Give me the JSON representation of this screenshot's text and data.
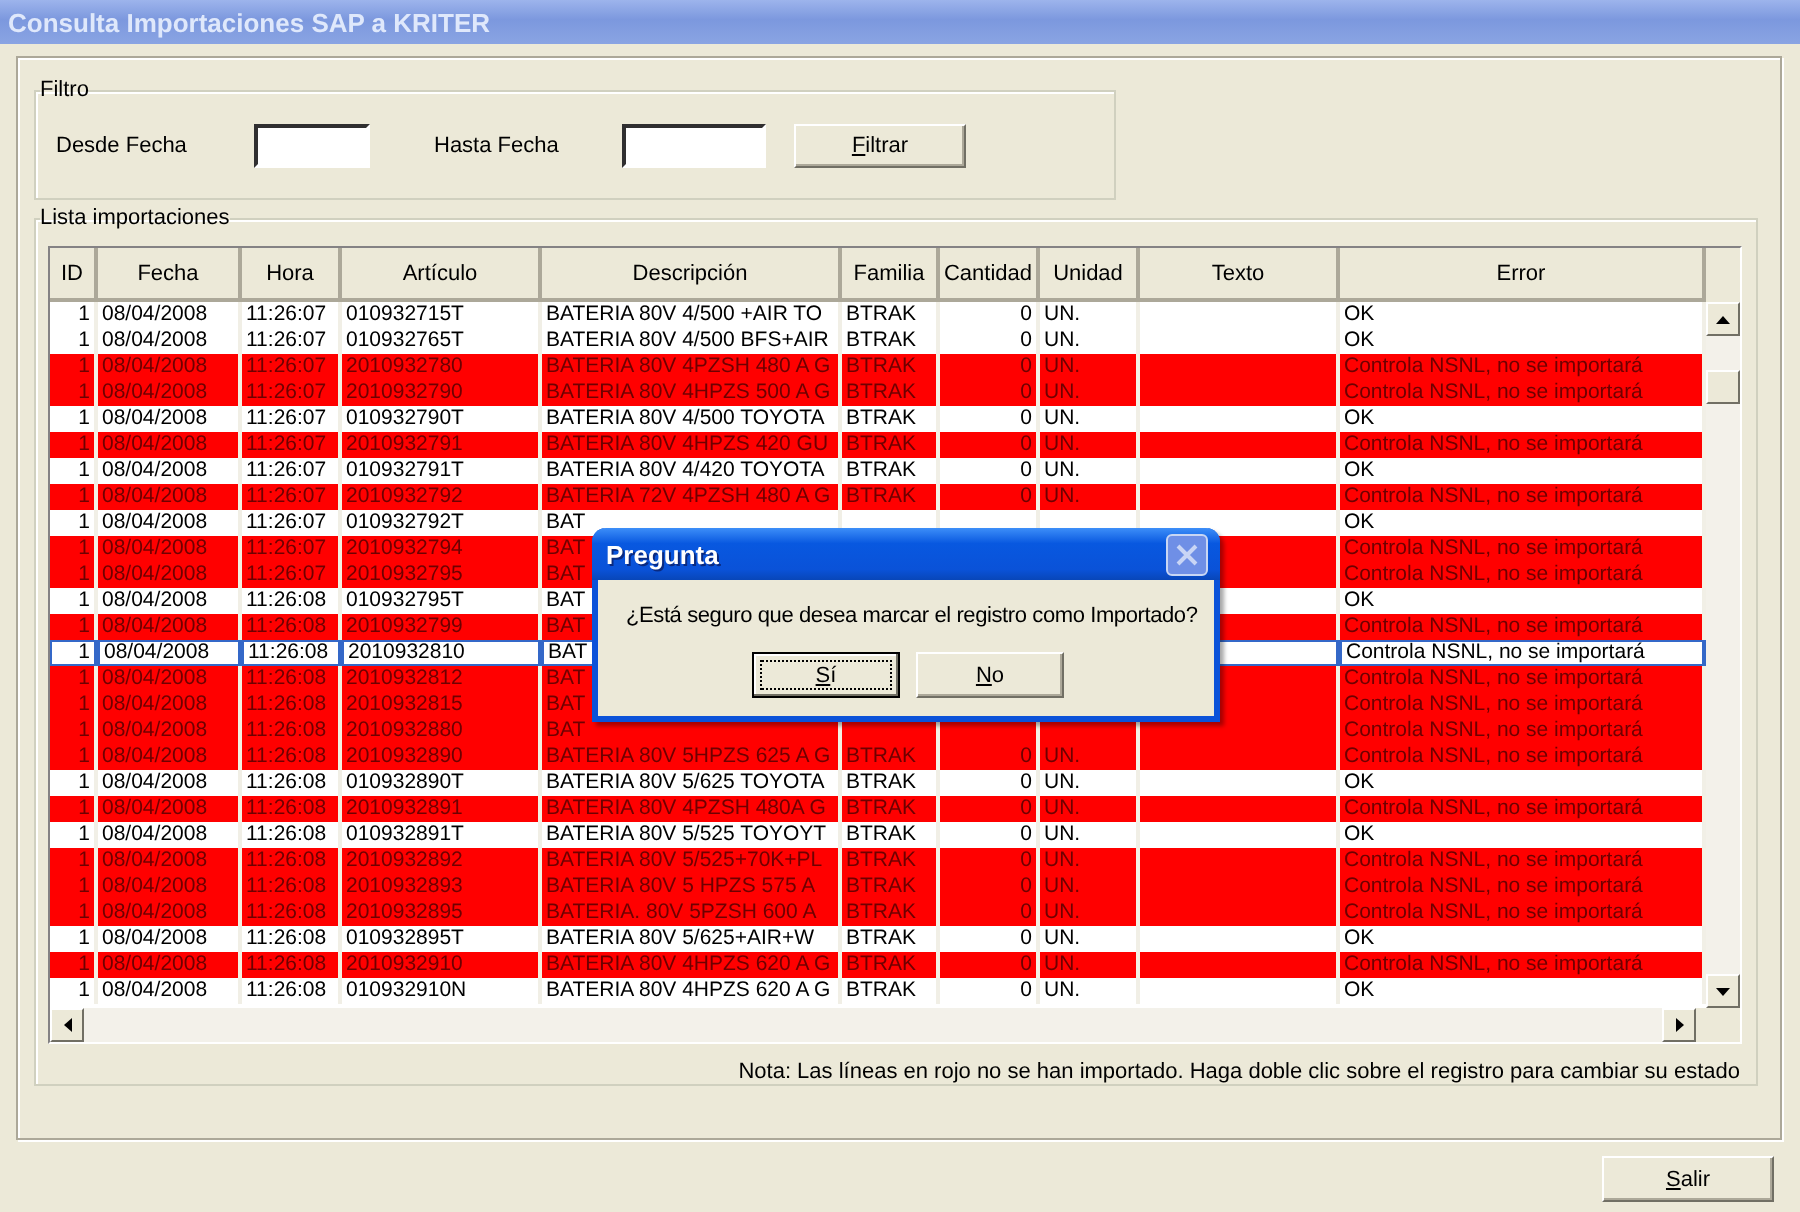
{
  "window": {
    "title": "Consulta Importaciones SAP a KRITER"
  },
  "filter": {
    "title": "Filtro",
    "fields": [
      {
        "label": "Desde Fecha"
      },
      {
        "label": "Hasta Fecha"
      }
    ],
    "button": "Filtrar"
  },
  "list": {
    "title": "Lista importaciones",
    "columns": [
      {
        "label": "ID"
      },
      {
        "label": "Fecha"
      },
      {
        "label": "Hora"
      },
      {
        "label": "Artículo"
      },
      {
        "label": "Descripción"
      },
      {
        "label": "Familia"
      },
      {
        "label": "Cantidad"
      },
      {
        "label": "Unidad"
      },
      {
        "label": "Texto"
      },
      {
        "label": "Error"
      }
    ],
    "rows": [
      {
        "id": "1",
        "fecha": "08/04/2008",
        "hora": "11:26:07",
        "articulo": "010932715T",
        "descripcion": "BATERIA 80V 4/500 +AIR TO",
        "familia": "BTRAK",
        "cantidad": "0",
        "unidad": "UN.",
        "error": "OK",
        "imported": true,
        "selected": false
      },
      {
        "id": "1",
        "fecha": "08/04/2008",
        "hora": "11:26:07",
        "articulo": "010932765T",
        "descripcion": "BATERIA 80V 4/500 BFS+AIR",
        "familia": "BTRAK",
        "cantidad": "0",
        "unidad": "UN.",
        "error": "OK",
        "imported": true,
        "selected": false
      },
      {
        "id": "1",
        "fecha": "08/04/2008",
        "hora": "11:26:07",
        "articulo": "2010932780",
        "descripcion": "BATERIA 80V 4PZSH 480 A G",
        "familia": "BTRAK",
        "cantidad": "0",
        "unidad": "UN.",
        "error": "Controla NSNL, no se importará",
        "imported": false,
        "selected": false
      },
      {
        "id": "1",
        "fecha": "08/04/2008",
        "hora": "11:26:07",
        "articulo": "2010932790",
        "descripcion": "BATERIA 80V 4HPZS 500 A G",
        "familia": "BTRAK",
        "cantidad": "0",
        "unidad": "UN.",
        "error": "Controla NSNL, no se importará",
        "imported": false,
        "selected": false
      },
      {
        "id": "1",
        "fecha": "08/04/2008",
        "hora": "11:26:07",
        "articulo": "010932790T",
        "descripcion": "BATERIA 80V 4/500 TOYOTA",
        "familia": "BTRAK",
        "cantidad": "0",
        "unidad": "UN.",
        "error": "OK",
        "imported": true,
        "selected": false
      },
      {
        "id": "1",
        "fecha": "08/04/2008",
        "hora": "11:26:07",
        "articulo": "2010932791",
        "descripcion": "BATERIA 80V 4HPZS 420 GU",
        "familia": "BTRAK",
        "cantidad": "0",
        "unidad": "UN.",
        "error": "Controla NSNL, no se importará",
        "imported": false,
        "selected": false
      },
      {
        "id": "1",
        "fecha": "08/04/2008",
        "hora": "11:26:07",
        "articulo": "010932791T",
        "descripcion": "BATERIA 80V 4/420 TOYOTA",
        "familia": "BTRAK",
        "cantidad": "0",
        "unidad": "UN.",
        "error": "OK",
        "imported": true,
        "selected": false
      },
      {
        "id": "1",
        "fecha": "08/04/2008",
        "hora": "11:26:07",
        "articulo": "2010932792",
        "descripcion": "BATERIA 72V 4PZSH 480 A G",
        "familia": "BTRAK",
        "cantidad": "0",
        "unidad": "UN.",
        "error": "Controla NSNL, no se importará",
        "imported": false,
        "selected": false
      },
      {
        "id": "1",
        "fecha": "08/04/2008",
        "hora": "11:26:07",
        "articulo": "010932792T",
        "descripcion": "BAT",
        "error": "OK",
        "imported": true,
        "selected": false
      },
      {
        "id": "1",
        "fecha": "08/04/2008",
        "hora": "11:26:07",
        "articulo": "2010932794",
        "descripcion": "BAT",
        "error": "Controla NSNL, no se importará",
        "imported": false,
        "selected": false
      },
      {
        "id": "1",
        "fecha": "08/04/2008",
        "hora": "11:26:07",
        "articulo": "2010932795",
        "descripcion": "BAT",
        "error": "Controla NSNL, no se importará",
        "imported": false,
        "selected": false
      },
      {
        "id": "1",
        "fecha": "08/04/2008",
        "hora": "11:26:08",
        "articulo": "010932795T",
        "descripcion": "BAT",
        "error": "OK",
        "imported": true,
        "selected": false
      },
      {
        "id": "1",
        "fecha": "08/04/2008",
        "hora": "11:26:08",
        "articulo": "2010932799",
        "descripcion": "BAT",
        "error": "Controla NSNL, no se importará",
        "imported": false,
        "selected": false
      },
      {
        "id": "1",
        "fecha": "08/04/2008",
        "hora": "11:26:08",
        "articulo": "2010932810",
        "descripcion": "BAT",
        "error": "Controla NSNL, no se importará",
        "imported": false,
        "selected": true
      },
      {
        "id": "1",
        "fecha": "08/04/2008",
        "hora": "11:26:08",
        "articulo": "2010932812",
        "descripcion": "BAT",
        "error": "Controla NSNL, no se importará",
        "imported": false,
        "selected": false
      },
      {
        "id": "1",
        "fecha": "08/04/2008",
        "hora": "11:26:08",
        "articulo": "2010932815",
        "descripcion": "BAT",
        "error": "Controla NSNL, no se importará",
        "imported": false,
        "selected": false
      },
      {
        "id": "1",
        "fecha": "08/04/2008",
        "hora": "11:26:08",
        "articulo": "2010932880",
        "descripcion": "BAT",
        "error": "Controla NSNL, no se importará",
        "imported": false,
        "selected": false
      },
      {
        "id": "1",
        "fecha": "08/04/2008",
        "hora": "11:26:08",
        "articulo": "2010932890",
        "descripcion": "BATERIA 80V 5HPZS 625 A G",
        "familia": "BTRAK",
        "cantidad": "0",
        "unidad": "UN.",
        "error": "Controla NSNL, no se importará",
        "imported": false,
        "selected": false
      },
      {
        "id": "1",
        "fecha": "08/04/2008",
        "hora": "11:26:08",
        "articulo": "010932890T",
        "descripcion": "BATERIA 80V 5/625 TOYOTA",
        "familia": "BTRAK",
        "cantidad": "0",
        "unidad": "UN.",
        "error": "OK",
        "imported": true,
        "selected": false
      },
      {
        "id": "1",
        "fecha": "08/04/2008",
        "hora": "11:26:08",
        "articulo": "2010932891",
        "descripcion": "BATERIA 80V 4PZSH 480A G",
        "familia": "BTRAK",
        "cantidad": "0",
        "unidad": "UN.",
        "error": "Controla NSNL, no se importará",
        "imported": false,
        "selected": false
      },
      {
        "id": "1",
        "fecha": "08/04/2008",
        "hora": "11:26:08",
        "articulo": "010932891T",
        "descripcion": "BATERIA 80V 5/525 TOYOYT",
        "familia": "BTRAK",
        "cantidad": "0",
        "unidad": "UN.",
        "error": "OK",
        "imported": true,
        "selected": false
      },
      {
        "id": "1",
        "fecha": "08/04/2008",
        "hora": "11:26:08",
        "articulo": "2010932892",
        "descripcion": "BATERIA 80V 5/525+70K+PL",
        "familia": "BTRAK",
        "cantidad": "0",
        "unidad": "UN.",
        "error": "Controla NSNL, no se importará",
        "imported": false,
        "selected": false
      },
      {
        "id": "1",
        "fecha": "08/04/2008",
        "hora": "11:26:08",
        "articulo": "2010932893",
        "descripcion": "BATERIA 80V 5 HPZS 575 A",
        "familia": "BTRAK",
        "cantidad": "0",
        "unidad": "UN.",
        "error": "Controla NSNL, no se importará",
        "imported": false,
        "selected": false
      },
      {
        "id": "1",
        "fecha": "08/04/2008",
        "hora": "11:26:08",
        "articulo": "2010932895",
        "descripcion": "BATERIA. 80V 5PZSH 600 A",
        "familia": "BTRAK",
        "cantidad": "0",
        "unidad": "UN.",
        "error": "Controla NSNL, no se importará",
        "imported": false,
        "selected": false
      },
      {
        "id": "1",
        "fecha": "08/04/2008",
        "hora": "11:26:08",
        "articulo": "010932895T",
        "descripcion": "BATERIA 80V 5/625+AIR+W",
        "familia": "BTRAK",
        "cantidad": "0",
        "unidad": "UN.",
        "error": "OK",
        "imported": true,
        "selected": false
      },
      {
        "id": "1",
        "fecha": "08/04/2008",
        "hora": "11:26:08",
        "articulo": "2010932910",
        "descripcion": "BATERIA 80V 4HPZS 620 A G",
        "familia": "BTRAK",
        "cantidad": "0",
        "unidad": "UN.",
        "error": "Controla NSNL, no se importará",
        "imported": false,
        "selected": false
      },
      {
        "id": "1",
        "fecha": "08/04/2008",
        "hora": "11:26:08",
        "articulo": "010932910N",
        "descripcion": "BATERIA 80V 4HPZS 620 A G",
        "familia": "BTRAK",
        "cantidad": "0",
        "unidad": "UN.",
        "error": "OK",
        "imported": true,
        "selected": false
      }
    ],
    "note": "Nota: Las líneas en rojo no se han importado. Haga doble clic sobre el registro para cambiar su estado"
  },
  "dialog": {
    "title": "Pregunta",
    "message": "¿Está seguro que desea marcar el registro como Importado?",
    "buttons": [
      {
        "label": "Sí",
        "focused": true
      },
      {
        "label": "No",
        "focused": false
      }
    ]
  },
  "footer": {
    "button": "Salir"
  }
}
